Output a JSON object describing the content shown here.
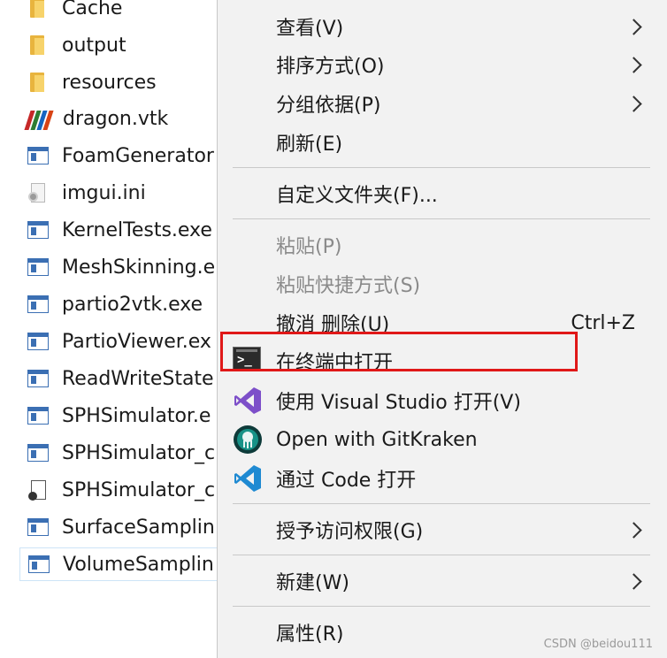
{
  "files": [
    {
      "name": "Cache",
      "icon": "folder-icon"
    },
    {
      "name": "output",
      "icon": "folder-icon"
    },
    {
      "name": "resources",
      "icon": "folder-icon"
    },
    {
      "name": "dragon.vtk",
      "icon": "vtk-file-icon"
    },
    {
      "name": "FoamGenerator",
      "icon": "exe-icon"
    },
    {
      "name": "imgui.ini",
      "icon": "settings-file-icon"
    },
    {
      "name": "KernelTests.exe",
      "icon": "exe-icon"
    },
    {
      "name": "MeshSkinning.e",
      "icon": "exe-icon"
    },
    {
      "name": "partio2vtk.exe",
      "icon": "exe-icon"
    },
    {
      "name": "PartioViewer.ex",
      "icon": "exe-icon"
    },
    {
      "name": "ReadWriteState",
      "icon": "exe-icon"
    },
    {
      "name": "SPHSimulator.e",
      "icon": "exe-icon"
    },
    {
      "name": "SPHSimulator_c",
      "icon": "exe-icon"
    },
    {
      "name": "SPHSimulator_c",
      "icon": "document-file-icon"
    },
    {
      "name": "SurfaceSamplin",
      "icon": "exe-icon"
    },
    {
      "name": "VolumeSamplin",
      "icon": "exe-icon",
      "selected": true
    }
  ],
  "menu": {
    "view": "查看(V)",
    "sort": "排序方式(O)",
    "group": "分组依据(P)",
    "refresh": "刷新(E)",
    "customize": "自定义文件夹(F)...",
    "paste": "粘贴(P)",
    "paste_shortcut": "粘贴快捷方式(S)",
    "undo": "撤消 删除(U)",
    "undo_shortcut": "Ctrl+Z",
    "open_terminal": "在终端中打开",
    "open_vs": "使用 Visual Studio 打开(V)",
    "open_gitkraken": "Open with GitKraken",
    "open_code": "通过 Code 打开",
    "grant_access": "授予访问权限(G)",
    "new": "新建(W)",
    "properties": "属性(R)"
  },
  "icons": {
    "terminal_glyph": ">_"
  },
  "colors": {
    "highlight": "#e01818",
    "vs_purple": "#7d4fc9",
    "vscode_blue": "#1f8ad2",
    "gitkraken_teal": "#179287",
    "vtk_stripes": [
      "#c62828",
      "#2e7d32",
      "#1565c0",
      "#d84315"
    ]
  },
  "watermark": "CSDN @beidou111"
}
